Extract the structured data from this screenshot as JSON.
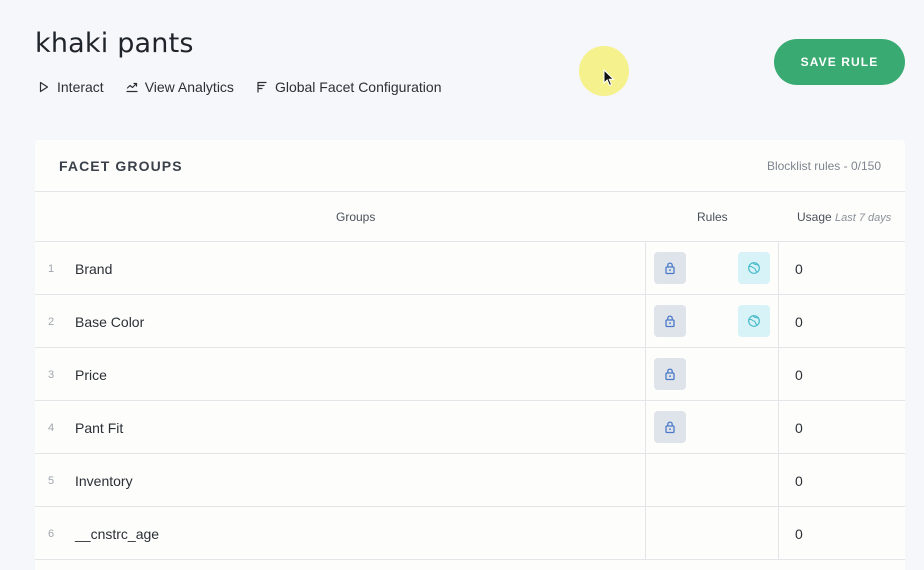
{
  "page": {
    "title": "khaki pants",
    "save_label": "SAVE RULE"
  },
  "actions": [
    {
      "label": "Interact",
      "icon": "play-icon"
    },
    {
      "label": "View Analytics",
      "icon": "analytics-icon"
    },
    {
      "label": "Global Facet Configuration",
      "icon": "filter-icon"
    }
  ],
  "card": {
    "title": "FACET GROUPS",
    "meta": "Blocklist rules - 0/150",
    "columns": {
      "groups": "Groups",
      "rules": "Rules",
      "usage": "Usage",
      "usage_period": "Last 7 days"
    }
  },
  "rows": [
    {
      "index": "1",
      "name": "Brand",
      "lock": true,
      "globe": true,
      "usage": "0"
    },
    {
      "index": "2",
      "name": "Base Color",
      "lock": true,
      "globe": true,
      "usage": "0"
    },
    {
      "index": "3",
      "name": "Price",
      "lock": true,
      "globe": false,
      "usage": "0"
    },
    {
      "index": "4",
      "name": "Pant Fit",
      "lock": true,
      "globe": false,
      "usage": "0"
    },
    {
      "index": "5",
      "name": "Inventory",
      "lock": false,
      "globe": false,
      "usage": "0"
    },
    {
      "index": "6",
      "name": "__cnstrc_age",
      "lock": false,
      "globe": false,
      "usage": "0"
    }
  ],
  "colors": {
    "accent": "#3aaa73",
    "lock_bg": "#dfe3ea",
    "lock_fg": "#4a7ac8",
    "globe_bg": "#d7f3f7",
    "globe_fg": "#44b9c9"
  }
}
